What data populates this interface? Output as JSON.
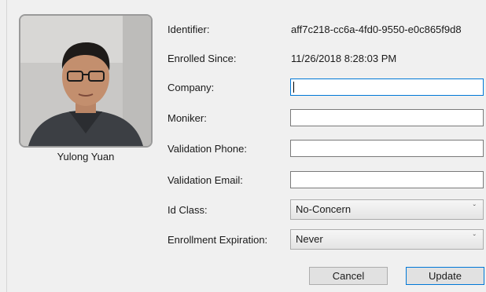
{
  "profile": {
    "name": "Yulong Yuan"
  },
  "fields": {
    "identifier": {
      "label": "Identifier:",
      "value": "aff7c218-cc6a-4fd0-9550-e0c865f9d8"
    },
    "enrolled_since": {
      "label": "Enrolled Since:",
      "value": "11/26/2018 8:28:03 PM"
    },
    "company": {
      "label": "Company:",
      "value": ""
    },
    "moniker": {
      "label": "Moniker:",
      "value": ""
    },
    "validation_phone": {
      "label": "Validation Phone:",
      "value": ""
    },
    "validation_email": {
      "label": "Validation Email:",
      "value": ""
    },
    "id_class": {
      "label": "Id Class:",
      "selected": "No-Concern"
    },
    "enrollment_expiration": {
      "label": "Enrollment Expiration:",
      "selected": "Never"
    }
  },
  "buttons": {
    "cancel": "Cancel",
    "update": "Update"
  },
  "colors": {
    "focus_border": "#0078d7",
    "background": "#f0f0f0"
  },
  "icons": {
    "dropdown": "chevron-down-icon"
  }
}
